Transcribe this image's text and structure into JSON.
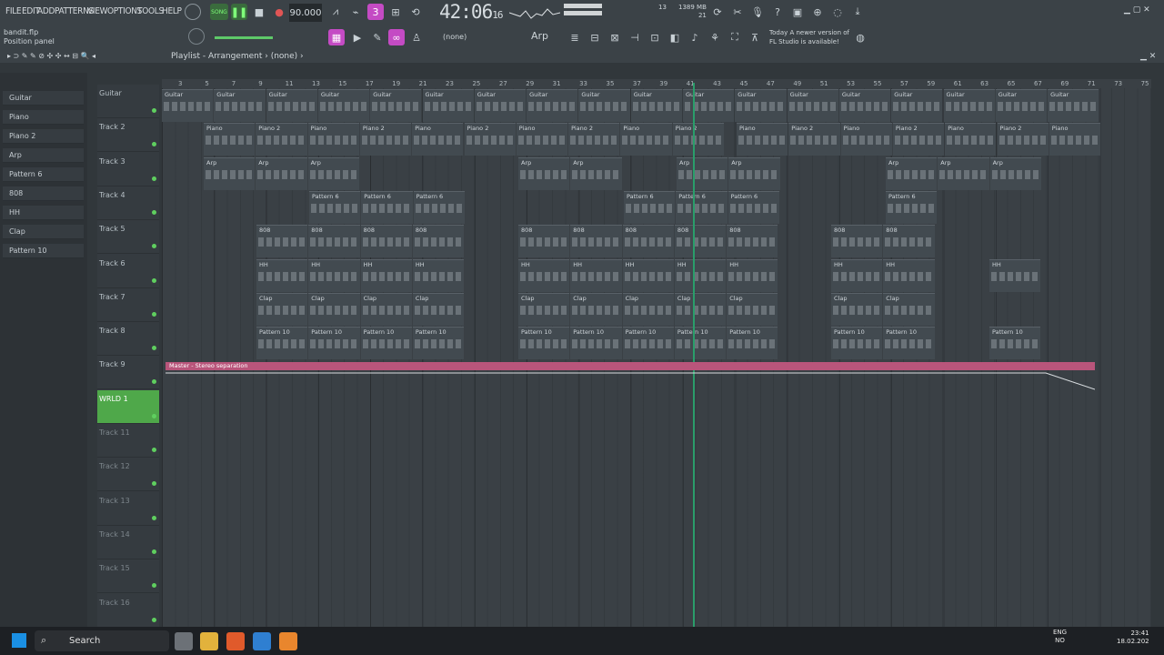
{
  "menu": [
    "FILE",
    "EDIT",
    "ADD",
    "PATTERNS",
    "VIEW",
    "OPTIONS",
    "TOOLS",
    "HELP"
  ],
  "transport": {
    "song_label": "SONG",
    "bpm": "90.000",
    "time": "42:06",
    "time_ticks": "16",
    "cpu_mem": "1389 MB",
    "cpu_voices": "21",
    "counter": "13"
  },
  "project": {
    "filename": "bandit.flp",
    "hint": "Position panel"
  },
  "toolbar2": {
    "pattern_name": "(none)",
    "channel_name": "Arp"
  },
  "update": {
    "line1": "Today  A newer version of",
    "line2": "FL Studio is available!"
  },
  "playlist": {
    "title": "Playlist - Arrangement",
    "pattern": "(none)"
  },
  "patterns": [
    "Guitar",
    "Piano",
    "Piano 2",
    "Arp",
    "Pattern 6",
    "808",
    "HH",
    "Clap",
    "Pattern 10"
  ],
  "tracks": [
    "Guitar",
    "Track 2",
    "Track 3",
    "Track 4",
    "Track 5",
    "Track 6",
    "Track 7",
    "Track 8",
    "Track 9",
    "WRLD 1",
    "Track 11",
    "Track 12",
    "Track 13",
    "Track 14",
    "Track 15",
    "Track 16"
  ],
  "bar_numbers": [
    "3",
    "5",
    "7",
    "9",
    "11",
    "13",
    "15",
    "17",
    "19",
    "21",
    "23",
    "25",
    "27",
    "29",
    "31",
    "33",
    "35",
    "37",
    "39",
    "41",
    "43",
    "45",
    "47",
    "49",
    "51",
    "53",
    "55",
    "57",
    "59",
    "61",
    "63",
    "65",
    "67",
    "69",
    "71",
    "73",
    "75"
  ],
  "automation_label": "Master - Stereo separation",
  "taskbar": {
    "search": "Search",
    "lang1": "ENG",
    "lang2": "NO",
    "time": "23:41",
    "date": "18.02.202"
  },
  "colors": {
    "accent": "#c44bc4",
    "playhead": "#2a9d6a",
    "automation": "#b9557b",
    "track_selected": "#4fa84a"
  }
}
